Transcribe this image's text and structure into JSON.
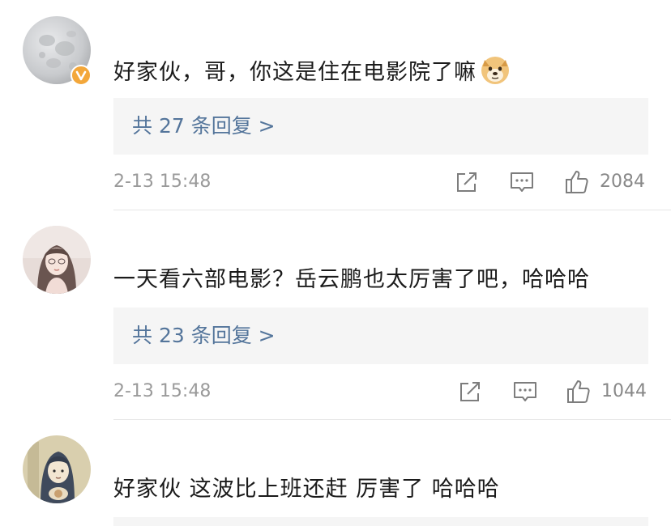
{
  "comments": [
    {
      "avatar": "moon-avatar",
      "verified": true,
      "text": "好家伙，哥，你这是住在电影院了嘛",
      "emoji": "doge-emoji",
      "replies": "共 27 条回复 >",
      "time": "2-13 15:48",
      "likes": "2084"
    },
    {
      "avatar": "girl-avatar",
      "verified": false,
      "text": "一天看六部电影？岳云鹏也太厉害了吧，哈哈哈",
      "replies": "共 23 条回复 >",
      "time": "2-13 15:48",
      "likes": "1044"
    },
    {
      "avatar": "cartoon-avatar",
      "verified": false,
      "text": "好家伙 这波比上班还赶 厉害了 哈哈哈"
    }
  ],
  "colors": {
    "reply_link": "#54759b",
    "verified_badge": "#f3a73a",
    "reply_bg": "#f5f5f5"
  }
}
